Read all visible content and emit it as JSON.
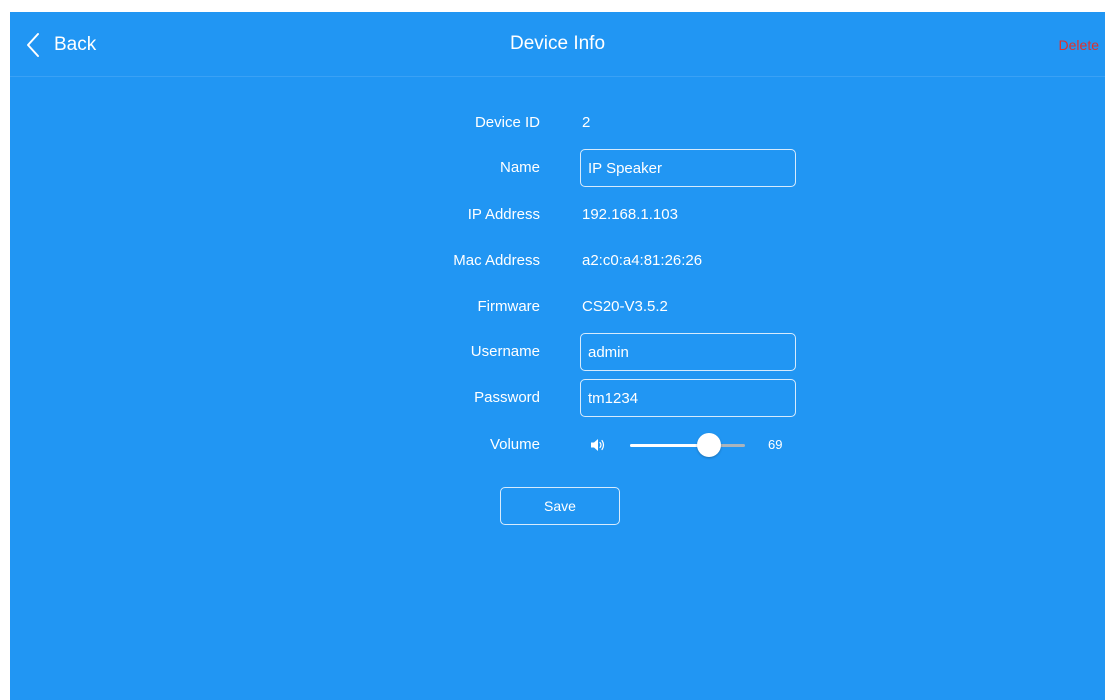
{
  "colors": {
    "background": "#2196f3",
    "text": "#ffffff",
    "delete": "#e0302b",
    "field_border": "#d6ebfd",
    "slider_track": "#a9b4bd"
  },
  "header": {
    "back_icon": "chevron-left-icon",
    "back_label": "Back",
    "title": "Device Info",
    "delete_label": "Delete"
  },
  "fields": {
    "device_id": {
      "label": "Device ID",
      "value": "2"
    },
    "name": {
      "label": "Name",
      "value": "IP Speaker"
    },
    "ip_address": {
      "label": "IP Address",
      "value": "192.168.1.103"
    },
    "mac_address": {
      "label": "Mac Address",
      "value": "a2:c0:a4:81:26:26"
    },
    "firmware": {
      "label": "Firmware",
      "value": "CS20-V3.5.2"
    },
    "username": {
      "label": "Username",
      "value": "admin"
    },
    "password": {
      "label": "Password",
      "value": "tm1234"
    },
    "volume": {
      "label": "Volume",
      "icon": "speaker-icon",
      "value": "69",
      "level": 0.69
    }
  },
  "actions": {
    "save_label": "Save"
  }
}
